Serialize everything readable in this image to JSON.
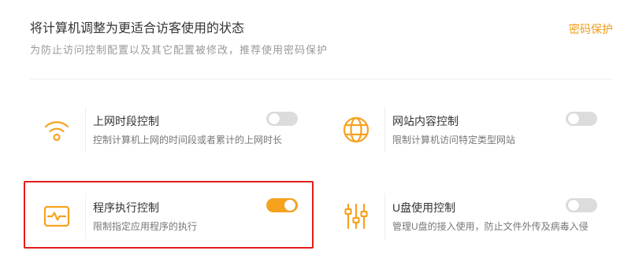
{
  "header": {
    "title": "将计算机调整为更适合访客使用的状态",
    "subtitle": "为防止访问控制配置以及其它配置被修改，推荐使用密码保护",
    "password_link": "密码保护"
  },
  "colors": {
    "accent": "#f6a21f",
    "link": "#f39c12",
    "highlight_border": "#e51c1c",
    "toggle_off": "#dcdcdc"
  },
  "cards": [
    {
      "icon": "wifi-icon",
      "title": "上网时段控制",
      "desc": "控制计算机上网的时间段或者累计的上网时长",
      "enabled": false
    },
    {
      "icon": "globe-icon",
      "title": "网站内容控制",
      "desc": "限制计算机访问特定类型网站",
      "enabled": false
    },
    {
      "icon": "monitor-pulse-icon",
      "title": "程序执行控制",
      "desc": "限制指定应用程序的执行",
      "enabled": true
    },
    {
      "icon": "sliders-icon",
      "title": "U盘使用控制",
      "desc": "管理U盘的接入使用，防止文件外传及病毒入侵",
      "enabled": false
    }
  ]
}
